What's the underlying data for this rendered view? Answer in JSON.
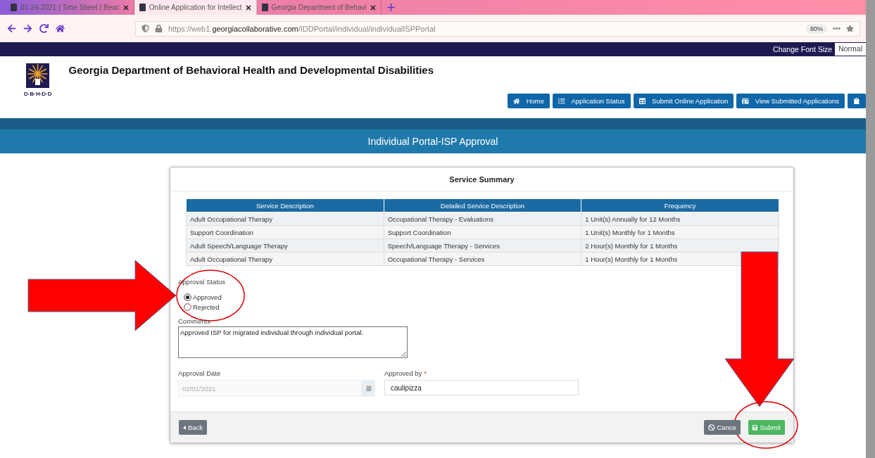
{
  "browser": {
    "tabs": [
      {
        "title": "01-24-2021 | Time Sheet | Beac",
        "selected": false
      },
      {
        "title": "Online Application for Intellect",
        "selected": true
      },
      {
        "title": "Georgia Department of Behavi",
        "selected": false
      }
    ],
    "url": {
      "prefix": "https://web1.",
      "domain": "georgiacollaborative.com",
      "path": "/IDDPortal/individual/individualISPPortal"
    },
    "zoom": "80%"
  },
  "topbar": {
    "label": "Change Font Size",
    "font_size": "Normal"
  },
  "header": {
    "logo_text": "D·B·H·D·D",
    "title": "Georgia Department of Behavioral Health and Developmental Disabilities",
    "nav": [
      "Home",
      "Application Status",
      "Submit Online Application",
      "View Submitted Applications"
    ]
  },
  "page_title": "Individual Portal-ISP Approval",
  "card": {
    "title": "Service Summary",
    "table": {
      "columns": [
        "Service Description",
        "Detailed Service Description",
        "Frequency"
      ],
      "rows": [
        [
          "Adult Occupational Therapy",
          "Occupational Therapy - Evaluations",
          "1 Unit(s) Annually for 12 Months"
        ],
        [
          "Support Coordination",
          "Support Coordination",
          "1 Unit(s) Monthly for 1 Months"
        ],
        [
          "Adult Speech/Language Therapy",
          "Speech/Language Therapy - Services",
          "2 Hour(s) Monthly for 1 Months"
        ],
        [
          "Adult Occupational Therapy",
          "Occupational Therapy - Services",
          "1 Hour(s) Monthly for 1 Months"
        ]
      ]
    },
    "approval_status": {
      "label": "Approval Status",
      "options": [
        {
          "label": "Approved",
          "selected": true
        },
        {
          "label": "Rejected",
          "selected": false
        }
      ]
    },
    "comments": {
      "label": "Comments",
      "value": "Approved ISP for migrated individual through individual portal."
    },
    "approval_date": {
      "label": "Approval Date",
      "value": "02/01/2021",
      "disabled": true
    },
    "approved_by": {
      "label": "Approved by",
      "required_mark": "*",
      "value": "caulipizza"
    },
    "buttons": {
      "back": "Back",
      "cancel": "Cance",
      "submit": "Submit"
    }
  }
}
